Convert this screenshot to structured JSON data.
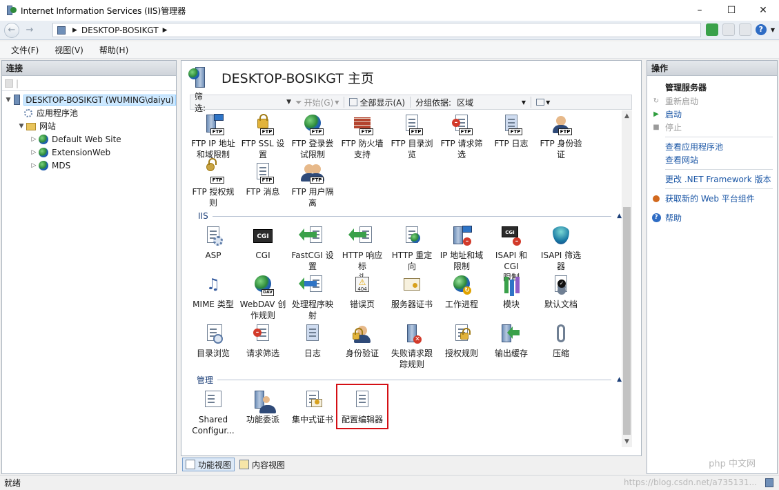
{
  "window": {
    "title": "Internet Information Services (IIS)管理器",
    "min": "–",
    "max": "☐",
    "close": "✕"
  },
  "address": {
    "host": "DESKTOP-BOSIKGT"
  },
  "menu": [
    "文件(F)",
    "视图(V)",
    "帮助(H)"
  ],
  "connections": {
    "title": "连接",
    "tree": {
      "server": "DESKTOP-BOSIKGT (WUMING\\daiyu)",
      "app_pools": "应用程序池",
      "sites": "网站",
      "site_list": [
        "Default Web Site",
        "ExtensionWeb",
        "MDS"
      ]
    }
  },
  "center": {
    "title": "DESKTOP-BOSIKGT 主页",
    "filter_label": "筛选:",
    "start_label": "开始(G)",
    "show_all_label": "全部显示(A)",
    "group_by_label": "分组依据:",
    "group_by_value": "区域",
    "ftp_features": [
      {
        "l1": "FTP IP 地址",
        "l2": "和域限制"
      },
      {
        "l1": "FTP SSL 设",
        "l2": "置"
      },
      {
        "l1": "FTP 登录尝",
        "l2": "试限制"
      },
      {
        "l1": "FTP 防火墙",
        "l2": "支持"
      },
      {
        "l1": "FTP 目录浏",
        "l2": "览"
      },
      {
        "l1": "FTP 请求筛",
        "l2": "选"
      },
      {
        "l1": "FTP 日志",
        "l2": ""
      },
      {
        "l1": "FTP 身份验",
        "l2": "证"
      },
      {
        "l1": "FTP 授权规",
        "l2": "则"
      },
      {
        "l1": "FTP 消息",
        "l2": ""
      },
      {
        "l1": "FTP 用户隔",
        "l2": "离"
      }
    ],
    "iis_section": "IIS",
    "iis_features": [
      {
        "l1": "ASP",
        "l2": ""
      },
      {
        "l1": "CGI",
        "l2": ""
      },
      {
        "l1": "FastCGI 设",
        "l2": "置"
      },
      {
        "l1": "HTTP 响应标",
        "l2": "头"
      },
      {
        "l1": "HTTP 重定向",
        "l2": ""
      },
      {
        "l1": "IP 地址和域",
        "l2": "限制"
      },
      {
        "l1": "ISAPI 和 CGI",
        "l2": "限制"
      },
      {
        "l1": "ISAPI 筛选器",
        "l2": ""
      },
      {
        "l1": "MIME 类型",
        "l2": ""
      },
      {
        "l1": "WebDAV 创",
        "l2": "作规则"
      },
      {
        "l1": "处理程序映",
        "l2": "射"
      },
      {
        "l1": "错误页",
        "l2": ""
      },
      {
        "l1": "服务器证书",
        "l2": ""
      },
      {
        "l1": "工作进程",
        "l2": ""
      },
      {
        "l1": "模块",
        "l2": ""
      },
      {
        "l1": "默认文档",
        "l2": ""
      },
      {
        "l1": "目录浏览",
        "l2": ""
      },
      {
        "l1": "请求筛选",
        "l2": ""
      },
      {
        "l1": "日志",
        "l2": ""
      },
      {
        "l1": "身份验证",
        "l2": ""
      },
      {
        "l1": "失败请求跟",
        "l2": "踪规则"
      },
      {
        "l1": "授权规则",
        "l2": ""
      },
      {
        "l1": "输出缓存",
        "l2": ""
      },
      {
        "l1": "压缩",
        "l2": ""
      }
    ],
    "mgmt_section": "管理",
    "mgmt_features": [
      {
        "l1": "Shared",
        "l2": "Configur..."
      },
      {
        "l1": "功能委派",
        "l2": ""
      },
      {
        "l1": "集中式证书",
        "l2": ""
      },
      {
        "l1": "配置编辑器",
        "l2": ""
      }
    ],
    "cgi_text": "CGI",
    "error_code": "404",
    "dav_text": "DAV",
    "ftp_tag": "FTP"
  },
  "actions": {
    "title": "操作",
    "group": "管理服务器",
    "items": [
      {
        "label": "重新启动",
        "icon": "↻",
        "enabled": false
      },
      {
        "label": "启动",
        "icon": "▶",
        "enabled": true
      },
      {
        "label": "停止",
        "icon": "■",
        "enabled": false
      }
    ],
    "links1": [
      "查看应用程序池",
      "查看网站"
    ],
    "links2": [
      "更改 .NET Framework 版本"
    ],
    "get_components": "获取新的 Web 平台组件",
    "help": "帮助"
  },
  "view_tabs": {
    "features": "功能视图",
    "content": "内容视图"
  },
  "status": {
    "text": "就绪"
  },
  "watermark": {
    "brand": "php 中文网",
    "url": "https://blog.csdn.net/a735131..."
  },
  "colors": {
    "highlight": "#d40f14",
    "link": "#1c57a6",
    "section": "#1c3f78"
  }
}
